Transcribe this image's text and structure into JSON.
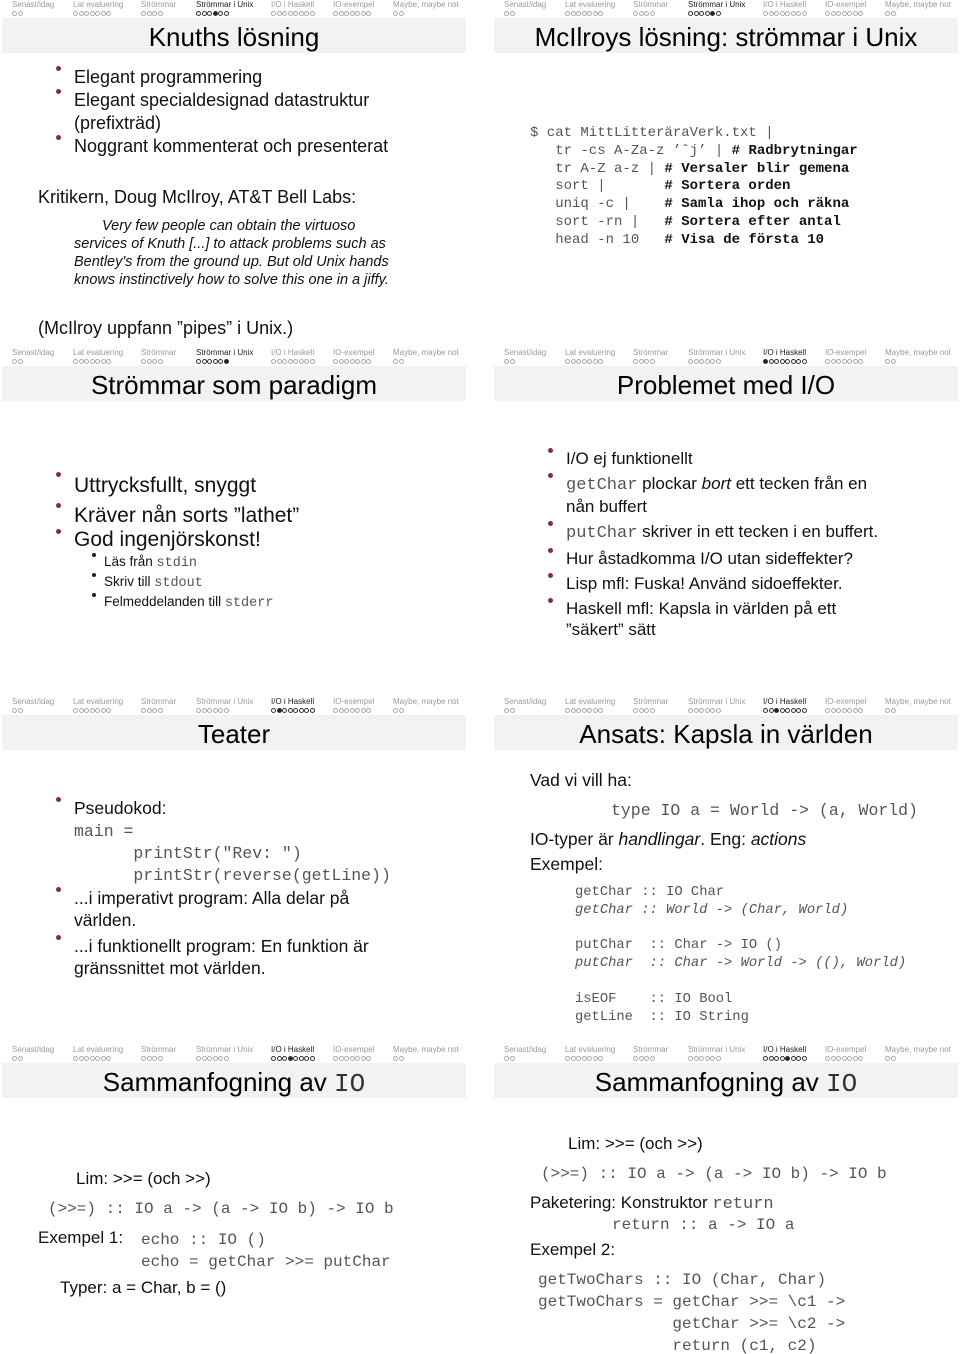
{
  "nav_sections": [
    {
      "label": "Senast/idag",
      "dots": 2
    },
    {
      "label": "Lat evaluering",
      "dots": 7
    },
    {
      "label": "Strömmar",
      "dots": 4
    },
    {
      "label": "Strömmar i Unix",
      "dots": 6
    },
    {
      "label": "I/O i Haskell",
      "dots": 8
    },
    {
      "label": "IO-exempel",
      "dots": 7
    },
    {
      "label": "Maybe, maybe not",
      "dots": 2
    }
  ],
  "colors": {
    "bullet": "#8b2a3a",
    "titlebar": "#f2f2f2",
    "nav_inactive": "#9a9a9a"
  },
  "slides": [
    {
      "title": "Knuths lösning",
      "active_section": 3,
      "active_dot": 3,
      "bullets": [
        "Elegant programmering",
        "Elegant specialdesignad datastruktur (prefixträd)",
        "Noggrant kommenterat och presenterat"
      ],
      "critic": "Kritikern, Doug McIlroy, AT&T Bell Labs:",
      "quote": "Very few people can obtain the virtuoso services of Knuth [...] to attack problems such as Bentley's from the ground up. But old Unix hands knows instinctively how to solve this one in a jiffy.",
      "footnote": "(McIlroy uppfann ”pipes” i Unix.)"
    },
    {
      "title": "McIlroys lösning: strömmar i Unix",
      "active_section": 3,
      "active_dot": 4,
      "pipeline": [
        {
          "cmd": "$ cat MittLitteräraVerk.txt |",
          "comment": ""
        },
        {
          "cmd": "   tr -cs A-Za-z ’ˆj’ | ",
          "comment": "# Radbrytningar"
        },
        {
          "cmd": "   tr A-Z a-z | ",
          "comment": "# Versaler blir gemena"
        },
        {
          "cmd": "   sort |       ",
          "comment": "# Sortera orden"
        },
        {
          "cmd": "   uniq -c |    ",
          "comment": "# Samla ihop och räkna"
        },
        {
          "cmd": "   sort -rn |   ",
          "comment": "# Sortera efter antal"
        },
        {
          "cmd": "   head -n 10   ",
          "comment": "# Visa de första 10"
        }
      ]
    },
    {
      "title": "Strömmar som paradigm",
      "active_section": 3,
      "active_dot": 5,
      "bullets": [
        "Uttrycksfullt, snyggt",
        "Kräver nån sorts ”lathet”",
        "God ingenjörskonst!"
      ],
      "subbullets": [
        {
          "text": "Läs från ",
          "code": "stdin"
        },
        {
          "text": "Skriv till ",
          "code": "stdout"
        },
        {
          "text": "Felmeddelanden till ",
          "code": "stderr"
        }
      ]
    },
    {
      "title": "Problemet med I/O",
      "active_section": 4,
      "active_dot": 0,
      "b1": "I/O ej funktionellt",
      "b2_code": "getChar",
      "b2_a": " plockar ",
      "b2_em": "bort",
      "b2_b": " ett tecken från en nån buffert",
      "b3_code": "putChar",
      "b3_text": " skriver in ett tecken i en buffert.",
      "b4": "Hur åstadkomma I/O utan sideffekter?",
      "b5": "Lisp mfl: Fuska! Använd sidoeffekter.",
      "b6": "Haskell mfl: Kapsla in världen på ett ”säkert” sätt"
    },
    {
      "title": "Teater",
      "active_section": 4,
      "active_dot": 1,
      "b1": "Pseudokod:",
      "code": "main =\n      printStr(\"Rev: \")\n      printStr(reverse(getLine))",
      "b2": "...i imperativt program: Alla delar på världen.",
      "b3": "...i funktionellt program: En funktion är gränssnittet mot världen."
    },
    {
      "title": "Ansats: Kapsla in världen",
      "active_section": 4,
      "active_dot": 2,
      "want": "Vad vi vill ha:",
      "type_def": "type IO a = World -> (a, World)",
      "io_a": "IO-typer är ",
      "io_em1": "handlingar",
      "io_b": ". Eng: ",
      "io_em2": "actions",
      "example": "Exempel:",
      "sigs": [
        {
          "text": "getChar :: IO Char",
          "italic": false
        },
        {
          "text": "getChar :: World -> (Char, World)",
          "italic": true
        },
        {
          "text": "",
          "italic": false
        },
        {
          "text": "putChar  :: Char -> IO ()",
          "italic": false
        },
        {
          "text": "putChar  :: Char -> World -> ((), World)",
          "italic": true
        },
        {
          "text": "",
          "italic": false
        },
        {
          "text": "isEOF    :: IO Bool",
          "italic": false
        },
        {
          "text": "getLine  :: IO String",
          "italic": false
        }
      ]
    },
    {
      "title_text": "Sammanfogning av ",
      "title_code": "IO",
      "active_section": 4,
      "active_dot": 3,
      "lim_label": "Lim:",
      "lim_text": ">>= (och >>)",
      "bind_sig": "(>>=) :: IO a -> (a -> IO b) -> IO b",
      "ex1_label": "Exempel 1:",
      "ex1_code": "echo :: IO ()\necho = getChar >>= putChar",
      "types_label": "Typer:",
      "types_text": "a = Char, b = ()"
    },
    {
      "title_text": "Sammanfogning av ",
      "title_code": "IO",
      "active_section": 4,
      "active_dot": 4,
      "lim_label": "Lim:",
      "lim_text": ">>= (och >>)",
      "bind_sig": "(>>=) :: IO a -> (a -> IO b) -> IO b",
      "pack_label": "Paketering:",
      "pack_text": "Konstruktor ",
      "pack_code": "return",
      "return_sig": "return :: a -> IO a",
      "ex2_label": "Exempel 2:",
      "ex2_code": "getTwoChars :: IO (Char, Char)\ngetTwoChars = getChar >>= \\c1 ->\n              getChar >>= \\c2 ->\n              return (c1, c2)"
    }
  ]
}
